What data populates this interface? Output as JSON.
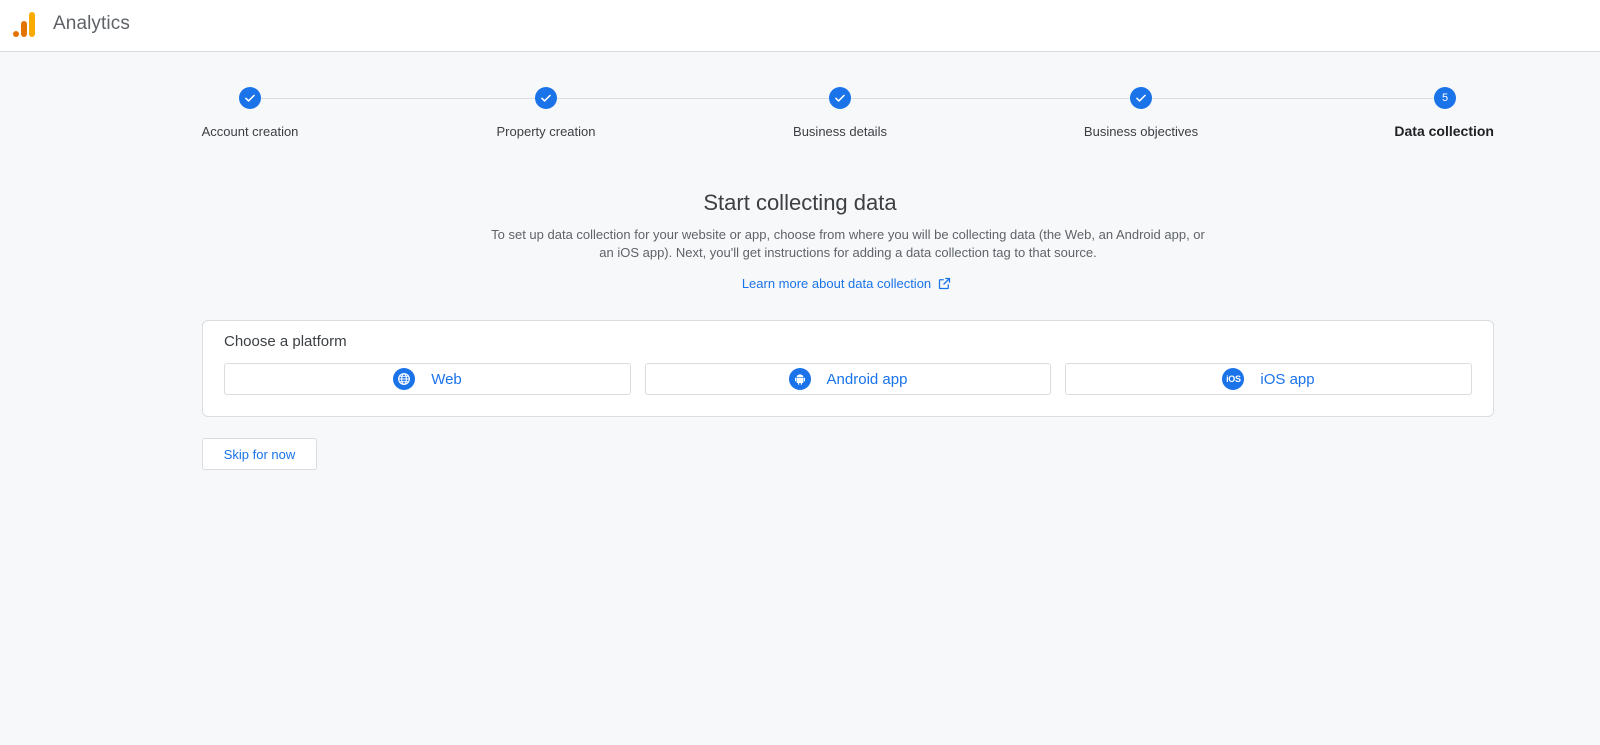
{
  "header": {
    "app_title": "Analytics",
    "logo_icon": "analytics-logo-icon",
    "colors": {
      "logo_dark": "#e37400",
      "logo_light": "#f9ab00"
    }
  },
  "stepper": {
    "steps": [
      {
        "label": "Account creation",
        "state": "complete",
        "icon": "check-icon"
      },
      {
        "label": "Property creation",
        "state": "complete",
        "icon": "check-icon"
      },
      {
        "label": "Business details",
        "state": "complete",
        "icon": "check-icon"
      },
      {
        "label": "Business objectives",
        "state": "complete",
        "icon": "check-icon"
      },
      {
        "label": "Data collection",
        "state": "current",
        "number": "5"
      }
    ]
  },
  "main": {
    "title": "Start collecting data",
    "description": "To set up data collection for your website or app, choose from where you will be collecting data (the Web, an Android app, or an iOS app). Next, you'll get instructions for adding a data collection tag to that source.",
    "learn_more": "Learn more about data collection",
    "learn_more_icon": "open-in-new-icon"
  },
  "platform_card": {
    "title": "Choose a platform",
    "options": [
      {
        "label": "Web",
        "icon": "globe-icon"
      },
      {
        "label": "Android app",
        "icon": "android-icon"
      },
      {
        "label": "iOS app",
        "icon": "ios-icon",
        "glyph": "iOS"
      }
    ]
  },
  "skip_button": "Skip for now",
  "colors": {
    "accent": "#1a73e8",
    "background": "#f7f8fa",
    "border": "#dadce0"
  }
}
